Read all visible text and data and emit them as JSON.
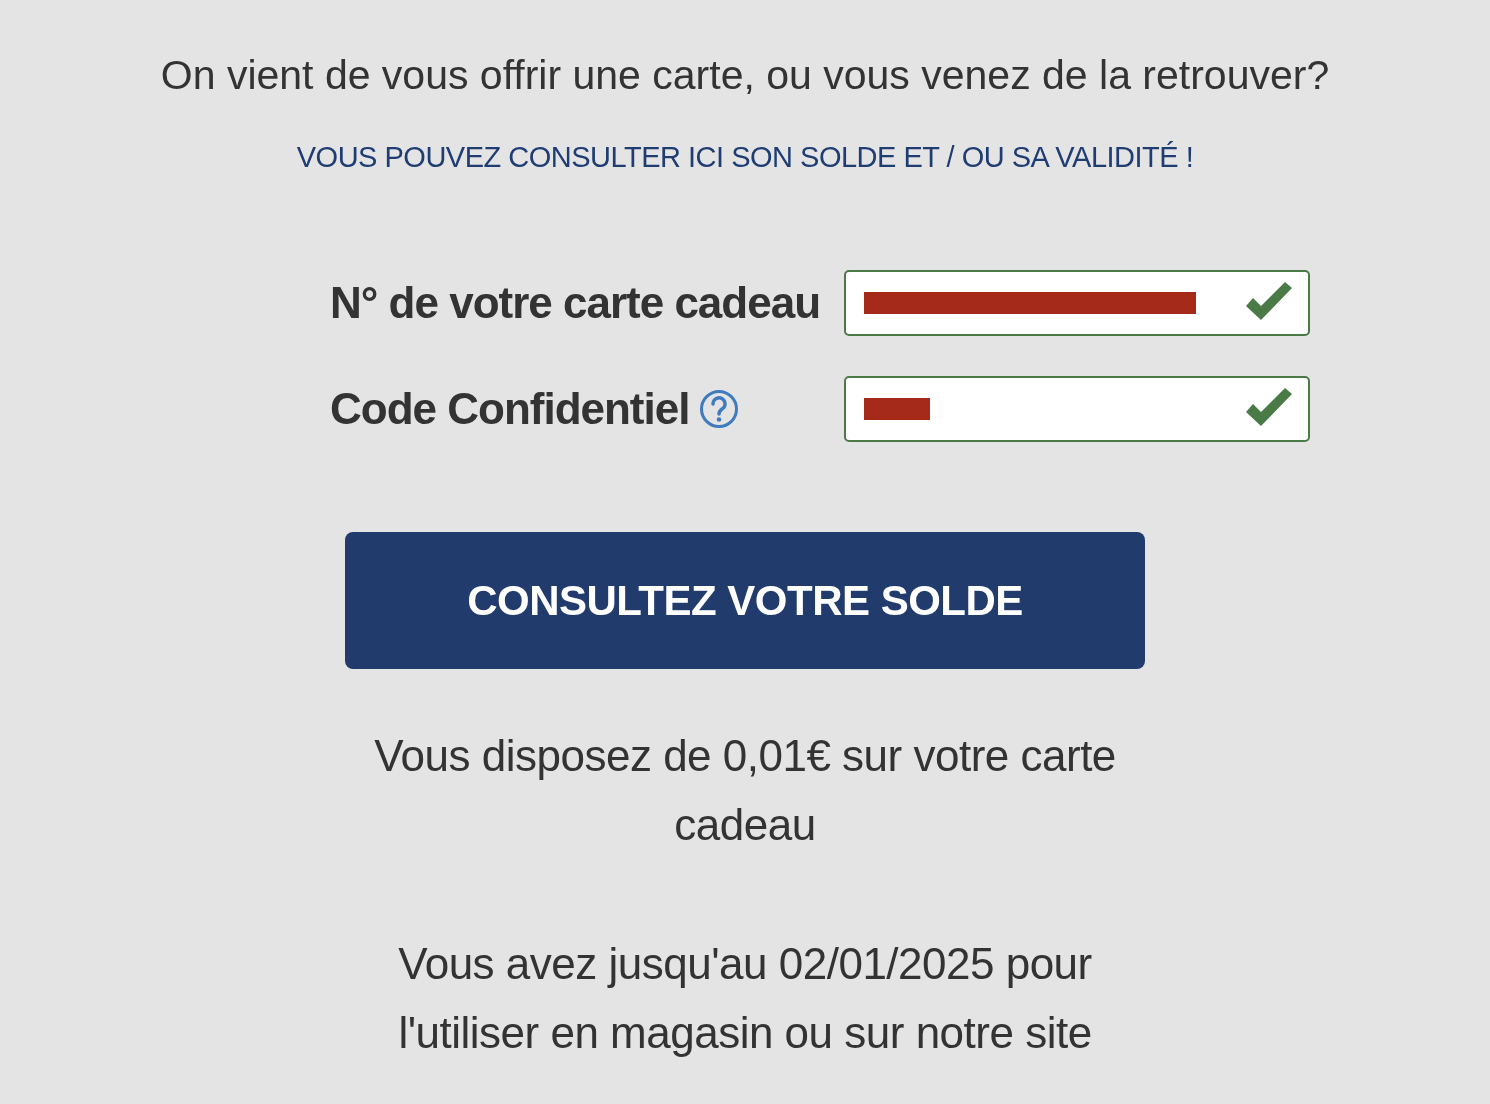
{
  "heading": "On vient de vous offrir une carte, ou vous venez de la retrouver?",
  "subheading": "VOUS POUVEZ CONSULTER ICI SON SOLDE ET / OU SA VALIDITÉ !",
  "fields": [
    {
      "label": "N° de votre carte cadeau",
      "help": false,
      "valid": true
    },
    {
      "label": "Code Confidentiel",
      "help": true,
      "valid": true
    }
  ],
  "button": "CONSULTEZ VOTRE SOLDE",
  "results": [
    "Vous disposez de 0,01€ sur votre carte cadeau",
    "Vous avez jusqu'au 02/01/2025 pour l'utiliser en magasin ou sur notre site"
  ]
}
